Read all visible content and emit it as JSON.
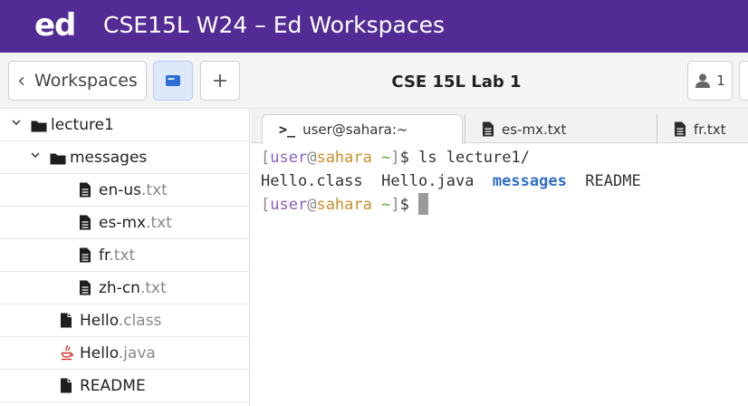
{
  "header": {
    "logo": "ed",
    "title": "CSE15L W24 – Ed Workspaces",
    "background": "#532b94"
  },
  "toolbar": {
    "back_label": "Workspaces",
    "lab_title": "CSE 15L Lab 1",
    "user_count": "1",
    "accent": "#dde8fb"
  },
  "file_tree": [
    {
      "indent": 0,
      "type": "folder",
      "expanded": true,
      "name": "lecture1",
      "ext": ""
    },
    {
      "indent": 1,
      "type": "folder",
      "expanded": true,
      "name": "messages",
      "ext": ""
    },
    {
      "indent": 2,
      "type": "file",
      "name": "en-us",
      "ext": ".txt"
    },
    {
      "indent": 2,
      "type": "file",
      "name": "es-mx",
      "ext": ".txt"
    },
    {
      "indent": 2,
      "type": "file",
      "name": "fr",
      "ext": ".txt"
    },
    {
      "indent": 2,
      "type": "file",
      "name": "zh-cn",
      "ext": ".txt"
    },
    {
      "indent": 1,
      "type": "file",
      "name": "Hello",
      "ext": ".class"
    },
    {
      "indent": 1,
      "type": "java",
      "name": "Hello",
      "ext": ".java"
    },
    {
      "indent": 1,
      "type": "file",
      "name": "README",
      "ext": ""
    }
  ],
  "tabs": [
    {
      "label": "user@sahara:~",
      "icon": "terminal-prompt-icon",
      "active": true
    },
    {
      "label": "es-mx.txt",
      "icon": "file-icon",
      "active": false
    },
    {
      "label": "fr.txt",
      "icon": "file-icon",
      "active": false
    }
  ],
  "terminal": {
    "user": "user",
    "at": "@",
    "host": "sahara",
    "cwd": "~",
    "lines": [
      {
        "kind": "prompt",
        "command": "ls lecture1/"
      },
      {
        "kind": "output",
        "items": [
          {
            "text": "Hello.class",
            "dir": false
          },
          {
            "text": "Hello.java",
            "dir": false
          },
          {
            "text": "messages",
            "dir": true
          },
          {
            "text": "README",
            "dir": false
          }
        ]
      },
      {
        "kind": "prompt",
        "command": "",
        "cursor": true
      }
    ]
  }
}
